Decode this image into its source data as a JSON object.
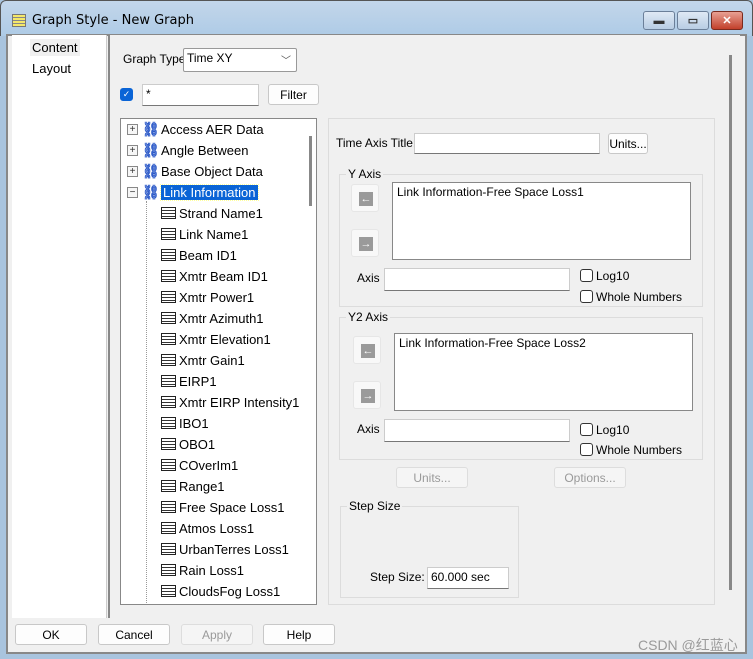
{
  "window": {
    "title": "Graph Style - New Graph",
    "minimize": "▬",
    "maximize": "▭",
    "close": "✕"
  },
  "nav": {
    "items": [
      {
        "label": "Content",
        "selected": true
      },
      {
        "label": "Layout"
      }
    ]
  },
  "graph_type": {
    "label": "Graph Type",
    "value": "Time XY"
  },
  "filter": {
    "checked": true,
    "value": "*",
    "button": "Filter"
  },
  "tree": {
    "groups": [
      {
        "label": "Access AER Data",
        "expanded": false
      },
      {
        "label": "Angle Between",
        "expanded": false
      },
      {
        "label": "Base Object Data",
        "expanded": false
      },
      {
        "label": "Link Information",
        "expanded": true,
        "selected": true
      }
    ],
    "children": [
      "Strand Name1",
      "Link Name1",
      "Beam ID1",
      "Xmtr Beam ID1",
      "Xmtr Power1",
      "Xmtr Azimuth1",
      "Xmtr Elevation1",
      "Xmtr Gain1",
      "EIRP1",
      "Xmtr EIRP Intensity1",
      "IBO1",
      "OBO1",
      "COverIm1",
      "Range1",
      "Free Space Loss1",
      "Atmos Loss1",
      "UrbanTerres Loss1",
      "Rain Loss1",
      "CloudsFog Loss1"
    ]
  },
  "time_axis": {
    "label": "Time Axis Title:",
    "value": "",
    "units_button": "Units..."
  },
  "y_axis": {
    "title": "Y Axis",
    "items": [
      "Link Information-Free Space Loss1"
    ],
    "axis_label": "Axis",
    "axis_value": "",
    "log10": "Log10",
    "whole_numbers": "Whole Numbers"
  },
  "y2_axis": {
    "title": "Y2 Axis",
    "items": [
      "Link Information-Free Space Loss2"
    ],
    "axis_label": "Axis",
    "axis_value": "",
    "log10": "Log10",
    "whole_numbers": "Whole Numbers"
  },
  "units_button": "Units...",
  "options_button": "Options...",
  "step_size": {
    "title": "Step Size",
    "label": "Step Size:",
    "value": "60.000 sec"
  },
  "footer": {
    "ok": "OK",
    "cancel": "Cancel",
    "apply": "Apply",
    "help": "Help"
  },
  "watermark": "CSDN @红蓝心"
}
